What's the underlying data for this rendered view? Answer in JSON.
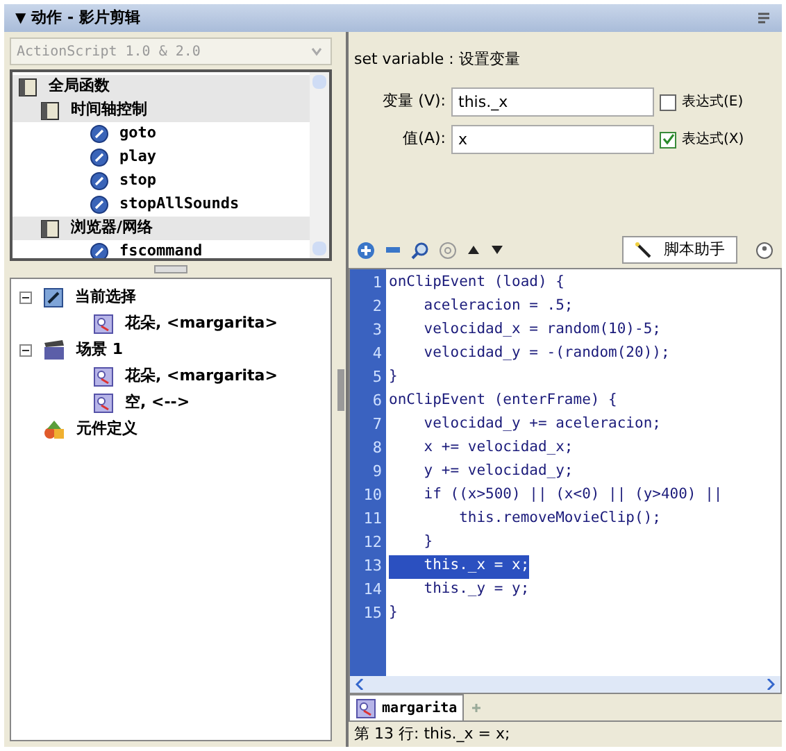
{
  "panel": {
    "title": "动作 - 影片剪辑",
    "toggle": "▼"
  },
  "version_select": {
    "value": "ActionScript 1.0 & 2.0"
  },
  "actions_tree": [
    {
      "kind": "book",
      "label": "全局函数",
      "children": [
        {
          "kind": "book",
          "label": "时间轴控制",
          "children": [
            {
              "kind": "action",
              "label": "goto"
            },
            {
              "kind": "action",
              "label": "play"
            },
            {
              "kind": "action",
              "label": "stop"
            },
            {
              "kind": "action",
              "label": "stopAllSounds"
            }
          ]
        },
        {
          "kind": "book",
          "label": "浏览器/网络",
          "children": [
            {
              "kind": "action",
              "label": "fscommand"
            }
          ]
        }
      ]
    }
  ],
  "script_tree": [
    {
      "kind": "selection",
      "label": "当前选择",
      "expanded": true,
      "children": [
        {
          "kind": "clip",
          "label": "花朵, <margarita>"
        }
      ]
    },
    {
      "kind": "scene",
      "label": "场景 1",
      "expanded": true,
      "children": [
        {
          "kind": "clip",
          "label": "花朵, <margarita>"
        },
        {
          "kind": "clip",
          "label": "空, <-->"
        }
      ]
    },
    {
      "kind": "symbols",
      "label": "元件定义"
    }
  ],
  "statement_title": "set variable : 设置变量",
  "fields": [
    {
      "label": "变量 (V):",
      "value": "this._x",
      "option": "表达式(E)",
      "checked": false
    },
    {
      "label": "值(A):",
      "value": "x",
      "option": "表达式(X)",
      "checked": true
    }
  ],
  "script_assist": "脚本助手",
  "code_lines": [
    {
      "number": "1",
      "text": "onClipEvent (load) {",
      "selected": false
    },
    {
      "number": "2",
      "text": "    aceleracion = .5;",
      "selected": false
    },
    {
      "number": "3",
      "text": "    velocidad_x = random(10)-5;",
      "selected": false
    },
    {
      "number": "4",
      "text": "    velocidad_y = -(random(20));",
      "selected": false
    },
    {
      "number": "5",
      "text": "}",
      "selected": false
    },
    {
      "number": "6",
      "text": "onClipEvent (enterFrame) {",
      "selected": false
    },
    {
      "number": "7",
      "text": "    velocidad_y += aceleracion;",
      "selected": false
    },
    {
      "number": "8",
      "text": "    x += velocidad_x;",
      "selected": false
    },
    {
      "number": "9",
      "text": "    y += velocidad_y;",
      "selected": false
    },
    {
      "number": "10",
      "text": "    if ((x>500) || (x<0) || (y>400) ||",
      "selected": false
    },
    {
      "number": "11",
      "text": "        this.removeMovieClip();",
      "selected": false
    },
    {
      "number": "12",
      "text": "    }",
      "selected": false
    },
    {
      "number": "13",
      "text": "    this._x = x;",
      "selected": true
    },
    {
      "number": "14",
      "text": "    this._y = y;",
      "selected": false
    },
    {
      "number": "15",
      "text": "}",
      "selected": false
    }
  ],
  "script_tab": {
    "label": "margarita"
  },
  "status_bar": "第 13 行: this._x = x;"
}
